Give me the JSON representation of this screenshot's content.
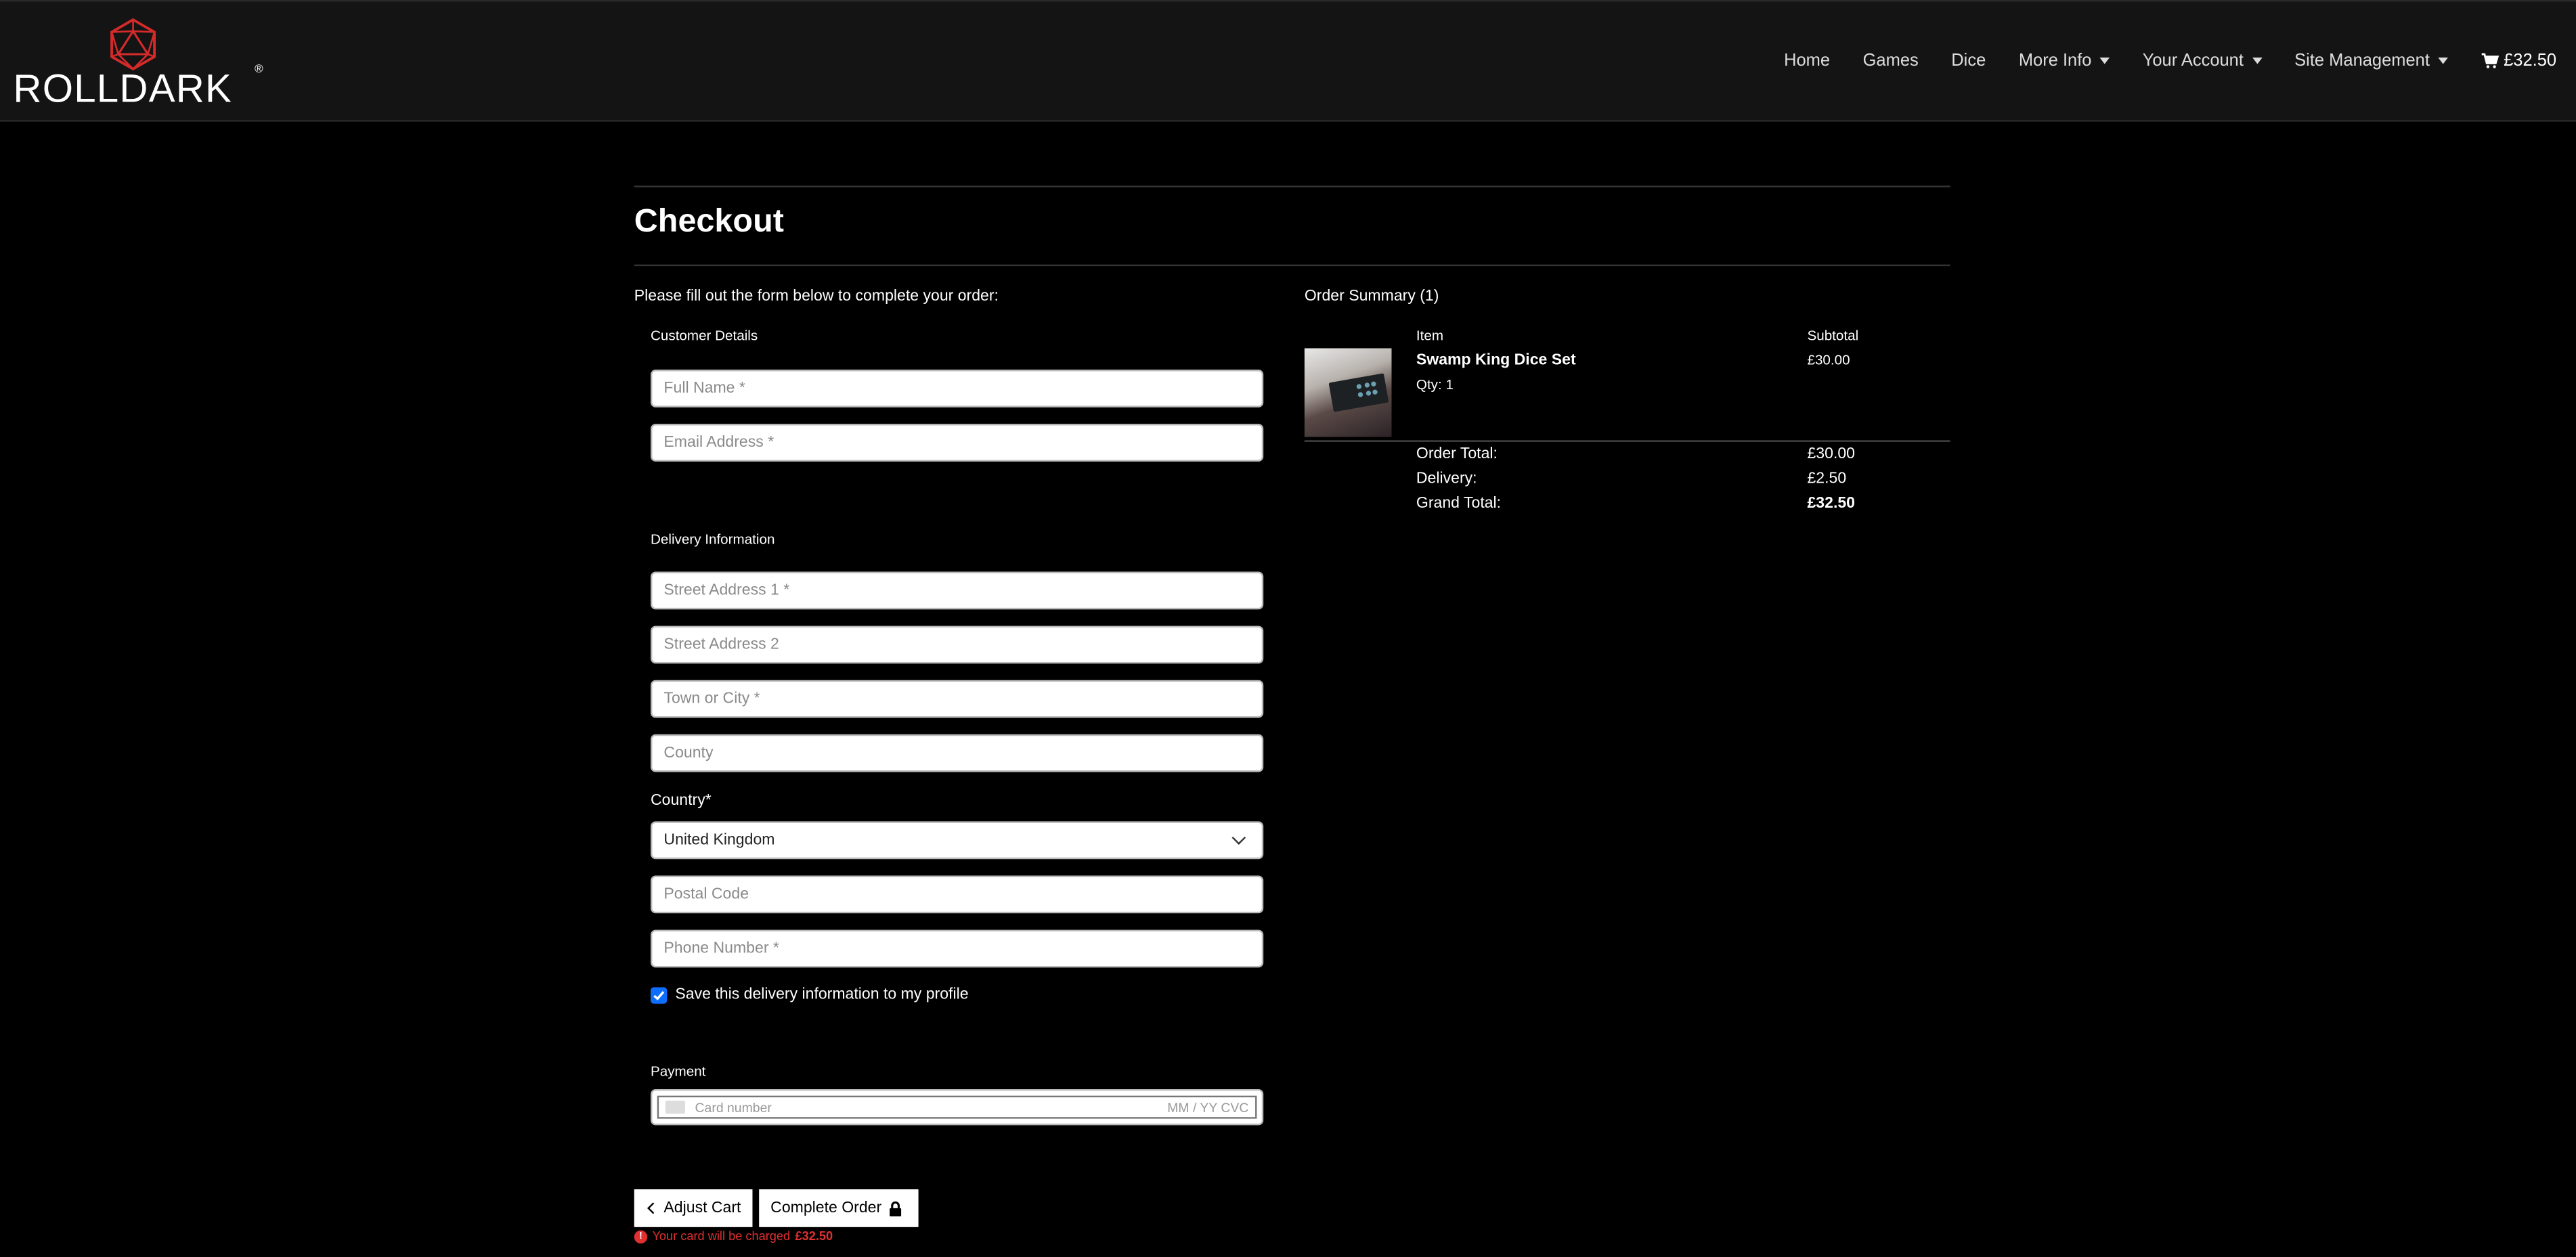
{
  "brand": {
    "name": "ROLLDARK",
    "registered": "®",
    "accent": "#d42a2a"
  },
  "nav": {
    "items": [
      {
        "label": "Home",
        "dropdown": false
      },
      {
        "label": "Games",
        "dropdown": false
      },
      {
        "label": "Dice",
        "dropdown": false
      },
      {
        "label": "More Info",
        "dropdown": true
      },
      {
        "label": "Your Account",
        "dropdown": true
      },
      {
        "label": "Site Management",
        "dropdown": true
      }
    ],
    "cart_total": "£32.50",
    "cart_icon": "cart-icon"
  },
  "page": {
    "title": "Checkout",
    "intro": "Please fill out the form below to complete your order:"
  },
  "form": {
    "customer_label": "Customer Details",
    "full_name_placeholder": "Full Name *",
    "email_placeholder": "Email Address *",
    "delivery_label": "Delivery Information",
    "street1_placeholder": "Street Address 1 *",
    "street2_placeholder": "Street Address 2",
    "town_placeholder": "Town or City *",
    "county_placeholder": "County",
    "country_label": "Country*",
    "country_value": "United Kingdom",
    "postcode_placeholder": "Postal Code",
    "phone_placeholder": "Phone Number *",
    "save_label": "Save this delivery information to my profile",
    "save_checked": true,
    "payment_label": "Payment",
    "card_placeholder": "Card number",
    "card_expiry_cvc": "MM / YY  CVC"
  },
  "actions": {
    "adjust_label": "Adjust Cart",
    "complete_label": "Complete Order",
    "charge_text": "Your card will be charged",
    "charge_amount": "£32.50"
  },
  "summary": {
    "title": "Order Summary (1)",
    "item_header": "Item",
    "subtotal_header": "Subtotal",
    "items": [
      {
        "name": "Swamp King Dice Set",
        "qty": "Qty: 1",
        "subtotal": "£30.00"
      }
    ],
    "order_total_label": "Order Total:",
    "order_total": "£30.00",
    "delivery_label": "Delivery:",
    "delivery": "£2.50",
    "grand_total_label": "Grand Total:",
    "grand_total": "£32.50"
  }
}
